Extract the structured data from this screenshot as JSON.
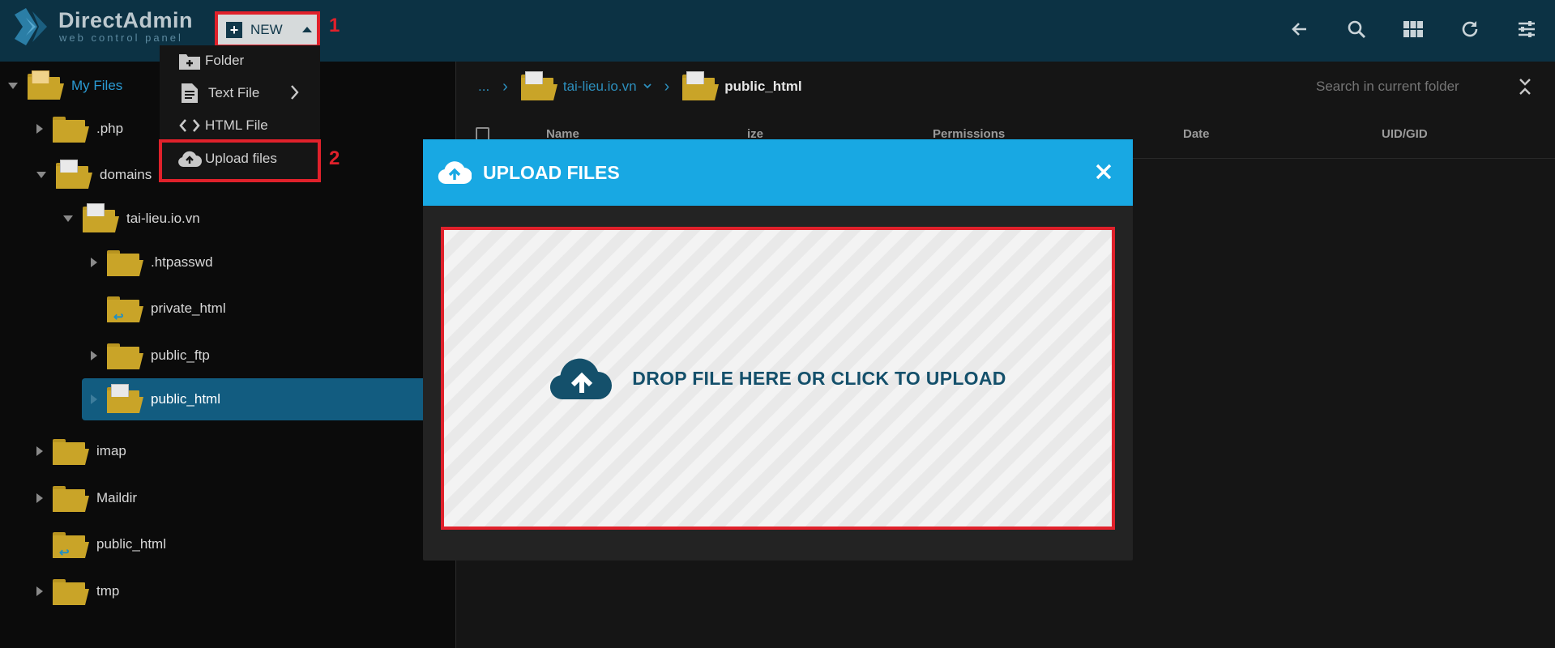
{
  "header": {
    "brand": "DirectAdmin",
    "tagline": "web control panel",
    "new_label": "NEW",
    "step1": "1",
    "step2": "2",
    "icons": [
      "arrow-left-icon",
      "search-icon",
      "grid-view-icon",
      "refresh-icon",
      "settings-sliders-icon"
    ]
  },
  "new_menu": {
    "items": [
      {
        "label": "Folder",
        "icon": "folder-add-icon"
      },
      {
        "label": "Text File",
        "icon": "text-file-icon"
      },
      {
        "label": "HTML File",
        "icon": "code-icon"
      },
      {
        "label": "Upload files",
        "icon": "cloud-upload-icon"
      }
    ]
  },
  "sidebar": {
    "root": "My Files",
    "items": [
      {
        "label": ".php"
      },
      {
        "label": "domains"
      },
      {
        "label": "tai-lieu.io.vn"
      },
      {
        "label": ".htpasswd"
      },
      {
        "label": "private_html"
      },
      {
        "label": "public_ftp"
      },
      {
        "label": "public_html"
      },
      {
        "label": "imap"
      },
      {
        "label": "Maildir"
      },
      {
        "label": "public_html"
      },
      {
        "label": "tmp"
      }
    ]
  },
  "breadcrumb": {
    "ellipsis": "...",
    "domain": "tai-lieu.io.vn",
    "current": "public_html"
  },
  "search": {
    "placeholder": "Search in current folder"
  },
  "table": {
    "columns": [
      "Name",
      "ize",
      "Permissions",
      "Date",
      "UID/GID"
    ]
  },
  "modal": {
    "title": "UPLOAD FILES",
    "drop_text": "DROP FILE HERE OR CLICK TO UPLOAD"
  },
  "colors": {
    "topbar": "#0c3244",
    "accent": "#18a8e3",
    "selected_row": "#125c80",
    "highlight": "#e0212b",
    "folder": "#c9a428"
  }
}
